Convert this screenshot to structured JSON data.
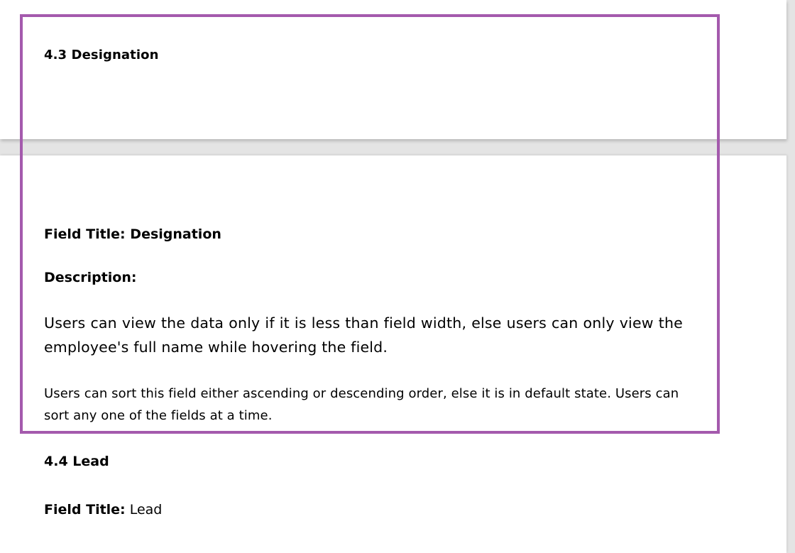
{
  "section_4_3": {
    "heading": "4.3  Designation"
  },
  "designation": {
    "field_title_label": "Field Title:",
    "field_title_value": "Designation",
    "description_label": "Description:",
    "paragraph_1": "Users can view the data only if it is less than field width, else users can only view the employee's full name while hovering the field.",
    "paragraph_2": "Users can sort this field either ascending or descending order, else it is in default state. Users can sort any one of the fields at a time."
  },
  "section_4_4": {
    "heading": "4.4 Lead",
    "field_title_label": "Field Title:",
    "field_title_value": "Lead"
  },
  "colors": {
    "highlight_border": "#a45aad",
    "viewer_background": "#e4e4e4",
    "page_background": "#ffffff"
  }
}
